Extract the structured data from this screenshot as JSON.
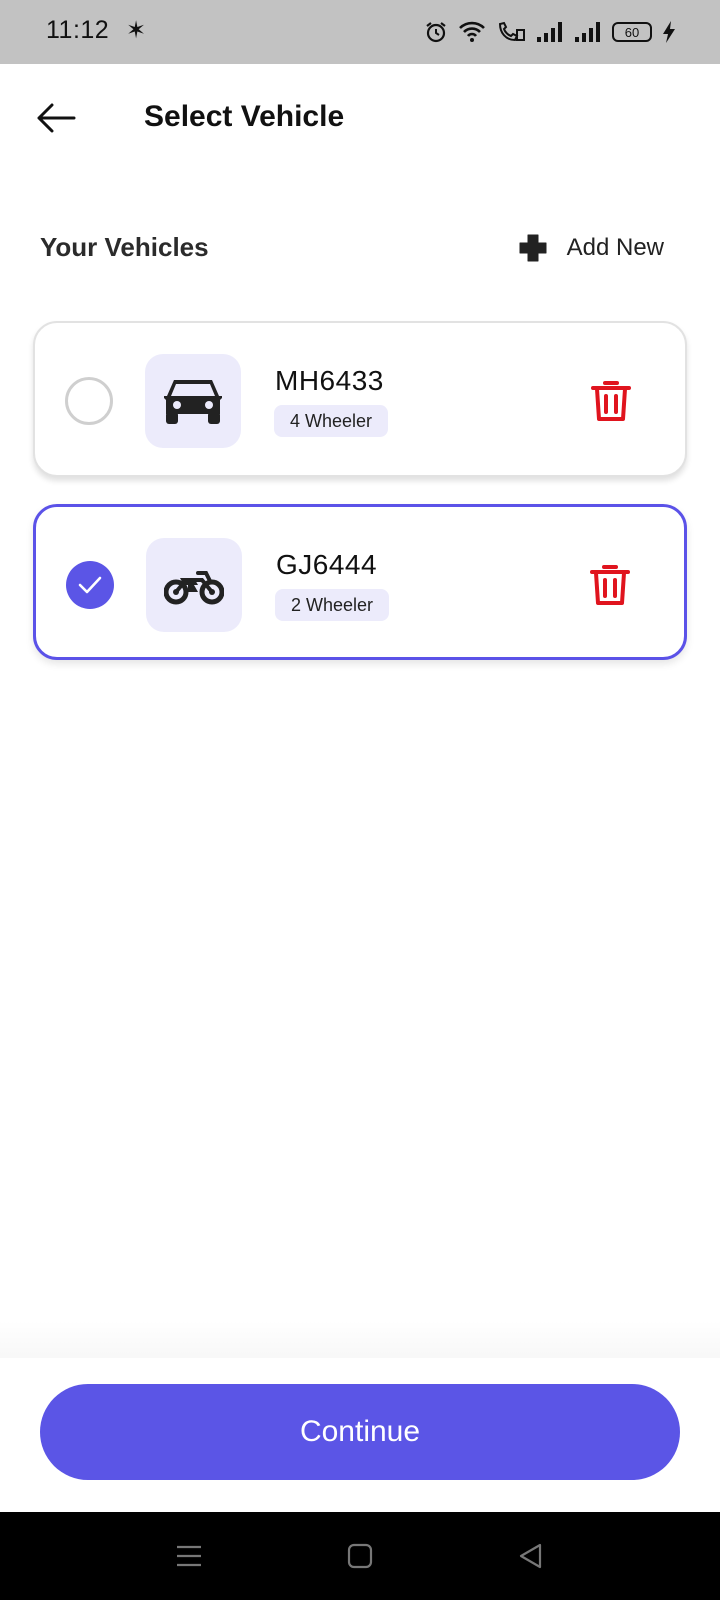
{
  "status_bar": {
    "time": "11:12",
    "extra_icon": "✶",
    "battery": "60",
    "icons": [
      "alarm-icon",
      "wifi-icon",
      "wifi-call-icon",
      "signal-icon",
      "signal-icon",
      "battery-icon",
      "charging-icon"
    ]
  },
  "header": {
    "title": "Select Vehicle",
    "back_icon": "back-arrow-icon"
  },
  "section": {
    "title": "Your Vehicles",
    "add_new_label": "Add New",
    "add_icon": "plus-icon"
  },
  "vehicles": [
    {
      "plate": "MH6433",
      "type": "4 Wheeler",
      "icon": "car-icon",
      "selected": false
    },
    {
      "plate": "GJ6444",
      "type": "2 Wheeler",
      "icon": "motorcycle-icon",
      "selected": true
    }
  ],
  "actions": {
    "continue_label": "Continue"
  },
  "colors": {
    "accent": "#5b55e6",
    "delete": "#e0141e",
    "icon_bg": "#ecebfb",
    "status_bar_bg": "#c2c2c2"
  },
  "nav": [
    "menu-icon",
    "home-icon",
    "back-triangle-icon"
  ]
}
